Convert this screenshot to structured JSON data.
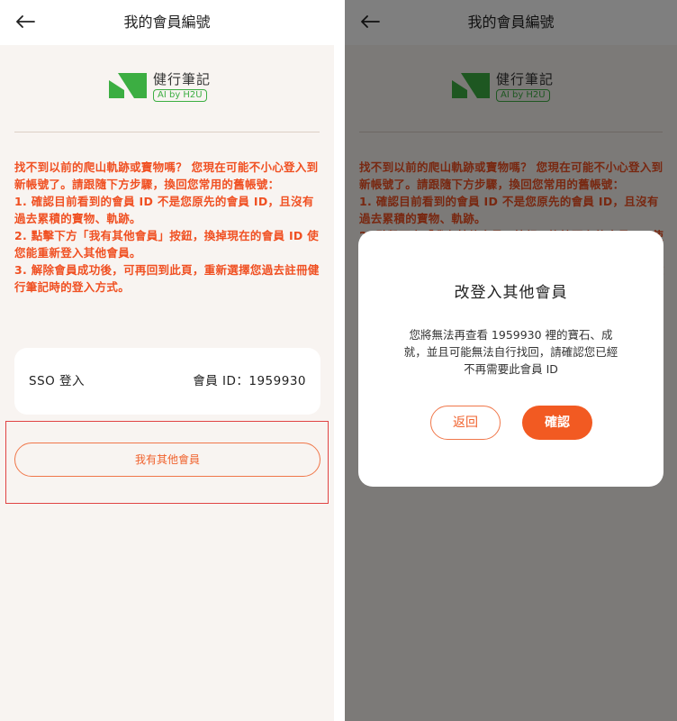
{
  "header": {
    "title": "我的會員編號"
  },
  "logo": {
    "name": "健行筆記",
    "badge": "AI by H2U"
  },
  "notice": {
    "text": "找不到以前的爬山軌跡或寶物嗎？ 您現在可能不小心登入到新帳號了。請跟隨下方步驟，換回您常用的舊帳號：\n1. 確認目前看到的會員 ID 不是您原先的會員 ID，且沒有過去累積的寶物、軌跡。\n2. 點擊下方「我有其他會員」按鈕，換掉現在的會員 ID 使您能重新登入其他會員。\n3. 解除會員成功後，可再回到此頁，重新選擇您過去註冊健行筆記時的登入方式。"
  },
  "account": {
    "login_type": "SSO 登入",
    "member_id_label": "會員 ID：1959930"
  },
  "other_member_button": "我有其他會員",
  "modal": {
    "title": "改登入其他會員",
    "message": "您將無法再查看 1959930 裡的寶石、成\n就，並且可能無法自行找回，請確認您已經\n不再需要此會員 ID",
    "cancel_label": "返回",
    "confirm_label": "確認"
  },
  "colors": {
    "accent": "#f25a22",
    "notice_text": "#f05022",
    "logo_green": "#3cae42",
    "highlight_box": "#e04444"
  },
  "icons": {
    "back": "arrow-left-icon",
    "logo": "hiking-logo-icon"
  }
}
